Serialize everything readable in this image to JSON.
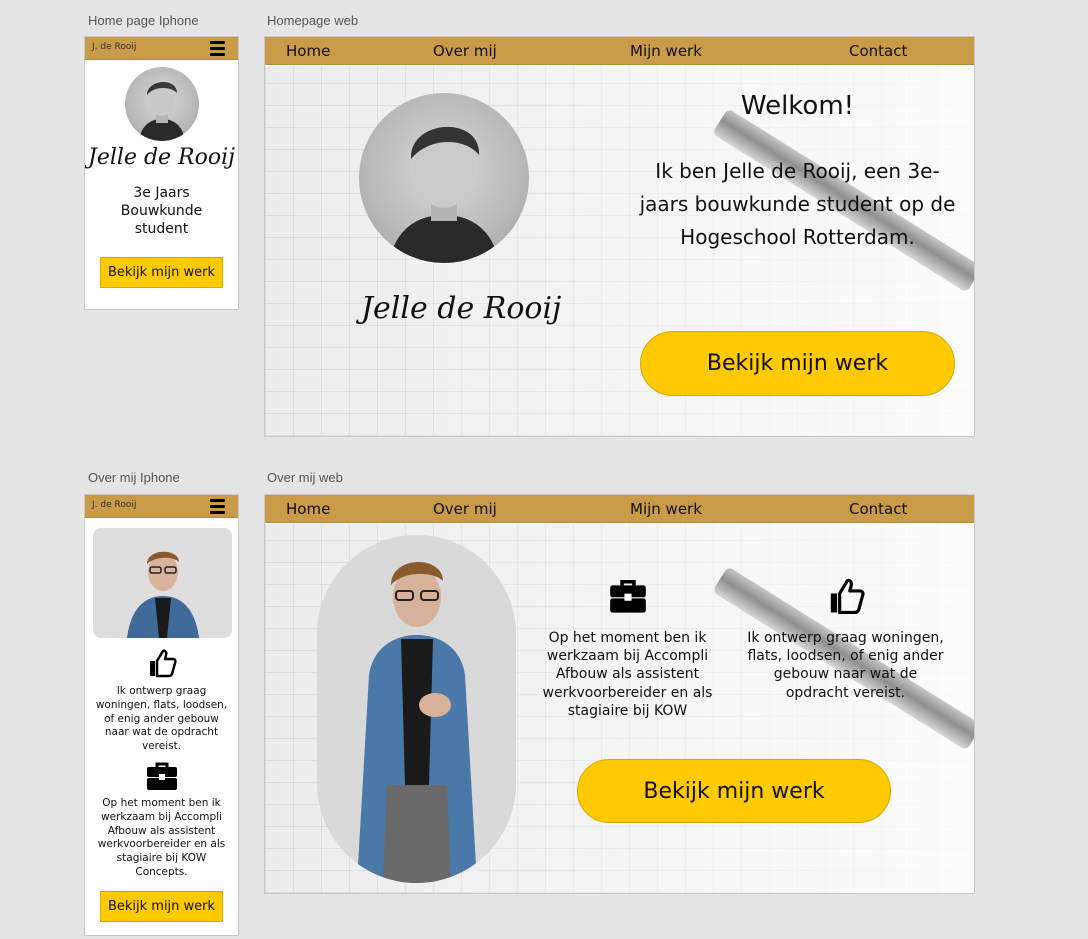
{
  "labels": {
    "home_phone": "Home page Iphone",
    "home_web": "Homepage web",
    "about_phone": "Over mij Iphone",
    "about_web": "Over mij web"
  },
  "phone": {
    "brand": "J. de Rooij",
    "menu_icon": "hamburger-icon"
  },
  "web_nav": {
    "home": "Home",
    "about": "Over mij",
    "work": "Mijn werk",
    "contact": "Contact"
  },
  "home_phone": {
    "name": "Jelle de Rooij",
    "subtitle": "3e Jaars Bouwkunde student",
    "cta": "Bekijk mijn werk"
  },
  "home_web": {
    "welcome": "Welkom!",
    "intro": "Ik ben Jelle de Rooij, een 3e-jaars bouwkunde student op de Hogeschool Rotterdam.",
    "name": "Jelle de Rooij",
    "cta": "Bekijk mijn werk"
  },
  "about_phone": {
    "like_text": "Ik ontwerp graag woningen, flats, loodsen, of enig ander gebouw naar wat de opdracht vereist.",
    "work_text": "Op het moment ben ik werkzaam bij Accompli Afbouw als assistent werkvoorbereider en als stagiaire bij KOW Concepts.",
    "cta": "Bekijk mijn werk"
  },
  "about_web": {
    "work_text": "Op het moment ben ik werkzaam bij Accompli Afbouw als assistent werkvoorbereider en als stagiaire bij KOW",
    "like_text": "Ik ontwerp graag woningen, flats, loodsen, of enig ander gebouw naar wat de opdracht vereist.",
    "cta": "Bekijk mijn werk"
  },
  "colors": {
    "nav_bar": "#c99b48",
    "cta": "#ffca00",
    "background": "#e5e5e5"
  }
}
